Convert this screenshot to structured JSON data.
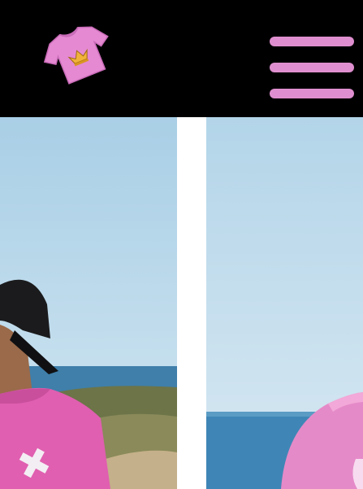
{
  "header": {
    "logo_icon": "pink-tshirt-crown-logo-icon",
    "menu_icon": "hamburger-menu-icon"
  },
  "gallery": {
    "items": [
      {
        "icon": "photo-man-pink-shirt-black-cap-coast"
      },
      {
        "icon": "photo-pink-shirt-shoulder-sea"
      }
    ]
  },
  "colors": {
    "header_background": "#000000",
    "accent_pink": "#df8fcf",
    "shirt_pink": "#e05fb0",
    "crown_gold": "#f0b23a",
    "sky": "#b9d9ec",
    "sea": "#3f7faa"
  }
}
